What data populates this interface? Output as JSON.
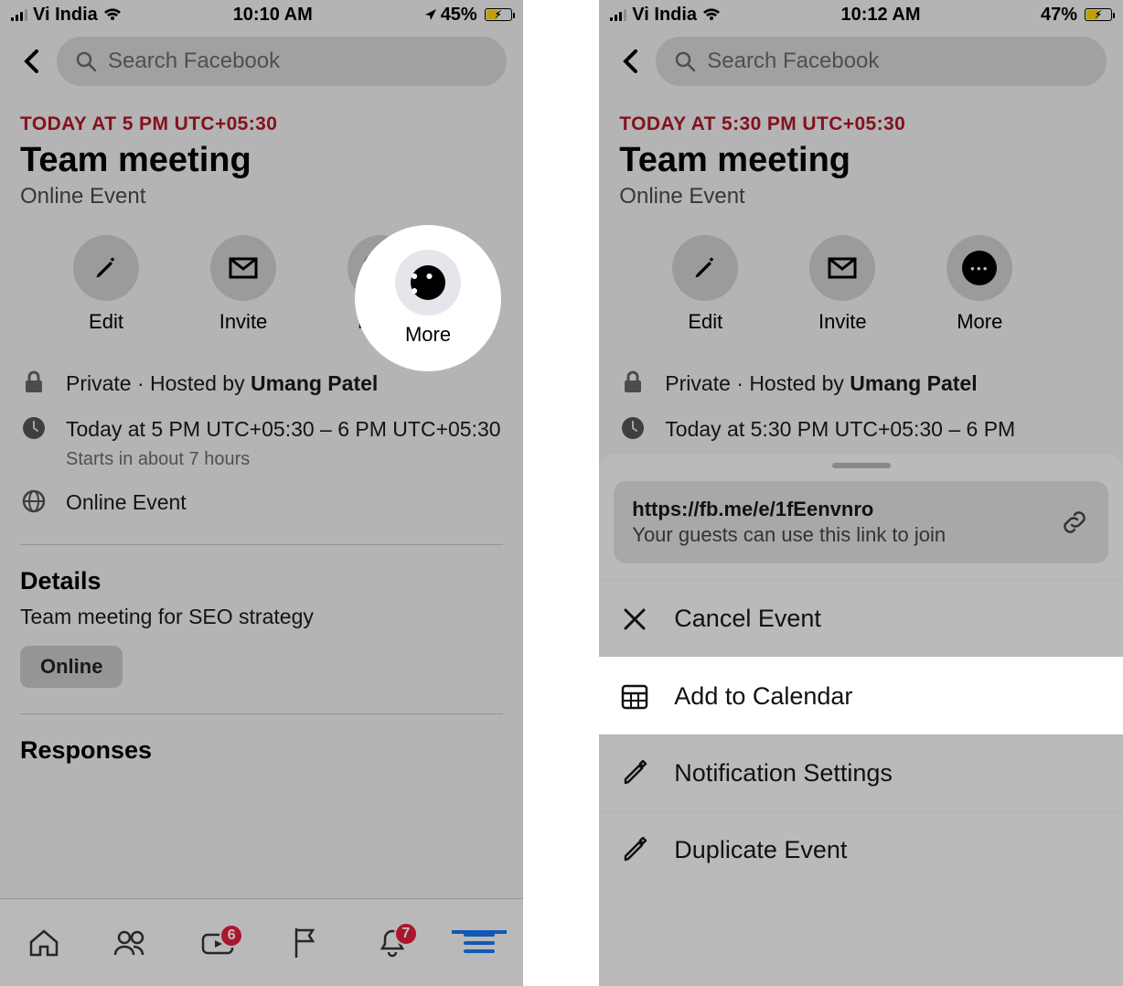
{
  "left": {
    "status": {
      "carrier": "Vi India",
      "time": "10:10 AM",
      "battery": "45%"
    },
    "search_placeholder": "Search Facebook",
    "date_text": "TODAY AT 5 PM UTC+05:30",
    "title": "Team meeting",
    "event_type": "Online Event",
    "actions": {
      "edit": "Edit",
      "invite": "Invite",
      "more": "More"
    },
    "privacy_prefix": "Private · Hosted by ",
    "host": "Umang Patel",
    "time_range": "Today at 5 PM UTC+05:30 – 6 PM UTC+05:30",
    "starts_in": "Starts in about 7 hours",
    "location": "Online Event",
    "details_heading": "Details",
    "details_body": "Team meeting for SEO strategy",
    "online_chip": "Online",
    "responses_heading": "Responses",
    "badge_watch": "6",
    "badge_bell": "7"
  },
  "right": {
    "status": {
      "carrier": "Vi India",
      "time": "10:12 AM",
      "battery": "47%"
    },
    "search_placeholder": "Search Facebook",
    "date_text": "TODAY AT 5:30 PM UTC+05:30",
    "title": "Team meeting",
    "event_type": "Online Event",
    "actions": {
      "edit": "Edit",
      "invite": "Invite",
      "more": "More"
    },
    "privacy_prefix": "Private · Hosted by ",
    "host": "Umang Patel",
    "time_range": "Today at 5:30 PM UTC+05:30 – 6 PM",
    "sheet": {
      "link_url": "https://fb.me/e/1fEenvnro",
      "link_note": "Your guests can use this link to join",
      "cancel": "Cancel Event",
      "add_calendar": "Add to Calendar",
      "notif": "Notification Settings",
      "dup": "Duplicate Event"
    }
  }
}
